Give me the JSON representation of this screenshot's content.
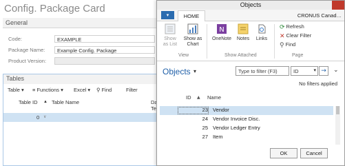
{
  "card": {
    "title": "Config. Package Card",
    "general": {
      "header": "General",
      "fields": [
        {
          "label": "Code:",
          "value": "EXAMPLE"
        },
        {
          "label": "Package Name:",
          "value": "Example Config. Package"
        },
        {
          "label": "Product Version:",
          "value": ""
        }
      ]
    },
    "tables": {
      "header": "Tables",
      "toolbar": {
        "table": "Table",
        "functions": "Functions",
        "excel": "Excel",
        "find": "Find",
        "filter": "Filter"
      },
      "columns": {
        "table_id": "Table ID",
        "table_name": "Table Name",
        "da": "Da",
        "te": "Te"
      },
      "row": {
        "table_id": "0"
      }
    }
  },
  "dialog": {
    "title": "Objects",
    "tab": "HOME",
    "company": "CRONUS Canad…",
    "ribbon": {
      "show_as_list": "Show as List",
      "show_as_chart": "Show as Chart",
      "group_view": "View",
      "onenote": "OneNote",
      "notes": "Notes",
      "links": "Links",
      "group_show_attached": "Show Attached",
      "refresh": "Refresh",
      "clear_filter": "Clear Filter",
      "find": "Find",
      "group_page": "Page"
    },
    "page_title": "Objects",
    "filter": {
      "placeholder": "Type to filter (F3)",
      "field": "ID"
    },
    "no_filters": "No filters applied",
    "columns": {
      "id": "ID",
      "name": "Name"
    },
    "rows": [
      {
        "id": "23",
        "name": "Vendor",
        "selected": true
      },
      {
        "id": "24",
        "name": "Vendor Invoice Disc.",
        "selected": false
      },
      {
        "id": "25",
        "name": "Vendor Ledger Entry",
        "selected": false
      },
      {
        "id": "27",
        "name": "Item",
        "selected": false
      }
    ],
    "buttons": {
      "ok": "OK",
      "cancel": "Cancel"
    }
  },
  "colors": {
    "accent": "#1f5fa8",
    "selection": "#cfe2f3",
    "close": "#c0392b"
  }
}
